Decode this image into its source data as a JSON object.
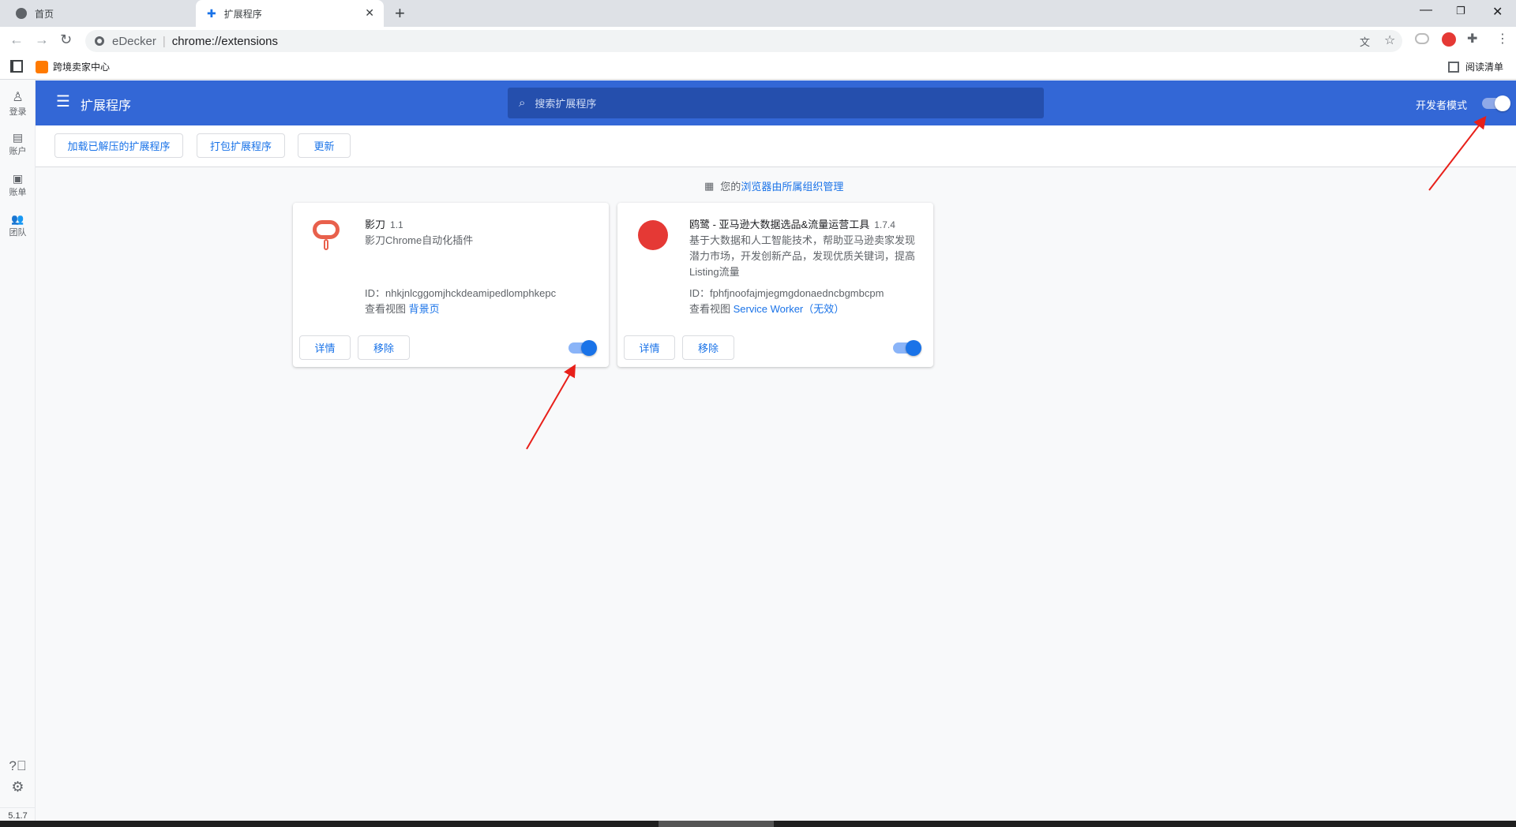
{
  "browser": {
    "tabs": [
      {
        "label": "首页",
        "icon": "globe-icon"
      },
      {
        "label": "扩展程序",
        "icon": "puzzle-icon",
        "active": true
      }
    ],
    "site_name": "eDecker",
    "url": "chrome://extensions",
    "bookmarks": [
      {
        "label": "跨境卖家中心"
      }
    ],
    "reading_list": "阅读清单"
  },
  "sidebar": {
    "items": [
      {
        "label": "登录"
      },
      {
        "label": "账户"
      },
      {
        "label": "账单"
      },
      {
        "label": "团队"
      }
    ],
    "version": "5.1.7"
  },
  "header": {
    "title": "扩展程序",
    "search_placeholder": "搜索扩展程序",
    "dev_mode_label": "开发者模式",
    "dev_mode_on": true
  },
  "toolbar": {
    "load_unpacked": "加载已解压的扩展程序",
    "pack": "打包扩展程序",
    "update": "更新"
  },
  "managed": {
    "prefix": "您的",
    "link": "浏览器由所属组织管理"
  },
  "extensions": [
    {
      "name": "影刀",
      "version": "1.1",
      "description": "影刀Chrome自动化插件",
      "id": "ID：nhkjnlcggomjhckdeamipedlomphkepc",
      "views_label": "查看视图",
      "view_link": "背景页",
      "view_suffix": "",
      "details": "详情",
      "remove": "移除",
      "enabled": true
    },
    {
      "name": "鸥鹭 - 亚马逊大数据选品&流量运营工具",
      "version": "1.7.4",
      "description": "基于大数据和人工智能技术，帮助亚马逊卖家发现潜力市场，开发创新产品，发现优质关键词，提高Listing流量",
      "id": "ID：fphfjnoofajmjegmgdonaedncbgmbcpm",
      "views_label": "查看视图",
      "view_link": "Service Worker",
      "view_suffix": "（无效）",
      "details": "详情",
      "remove": "移除",
      "enabled": true
    }
  ],
  "colors": {
    "header": "#3367d6",
    "accent": "#1a73e8",
    "arrow": "#e8201a"
  }
}
